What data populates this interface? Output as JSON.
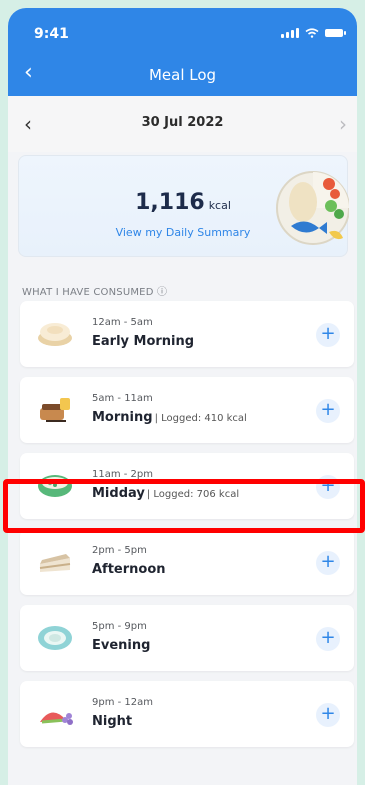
{
  "status": {
    "time": "9:41"
  },
  "header": {
    "title": "Meal Log"
  },
  "date_nav": {
    "date": "30 Jul 2022"
  },
  "summary": {
    "kcal": "1,116",
    "unit": "kcal",
    "link": "View my Daily Summary"
  },
  "section": {
    "heading": "WHAT I HAVE CONSUMED ⓘ"
  },
  "meals": [
    {
      "time": "12am - 5am",
      "name": "Early Morning",
      "logged": ""
    },
    {
      "time": "5am - 11am",
      "name": "Morning",
      "logged": "| Logged: 410 kcal"
    },
    {
      "time": "11am - 2pm",
      "name": "Midday",
      "logged": "| Logged: 706 kcal"
    },
    {
      "time": "2pm - 5pm",
      "name": "Afternoon",
      "logged": ""
    },
    {
      "time": "5pm - 9pm",
      "name": "Evening",
      "logged": ""
    },
    {
      "time": "9pm - 12am",
      "name": "Night",
      "logged": ""
    }
  ],
  "add_symbol": "+",
  "colors": {
    "primary": "#2f86e7",
    "highlight": "#ff0000"
  }
}
